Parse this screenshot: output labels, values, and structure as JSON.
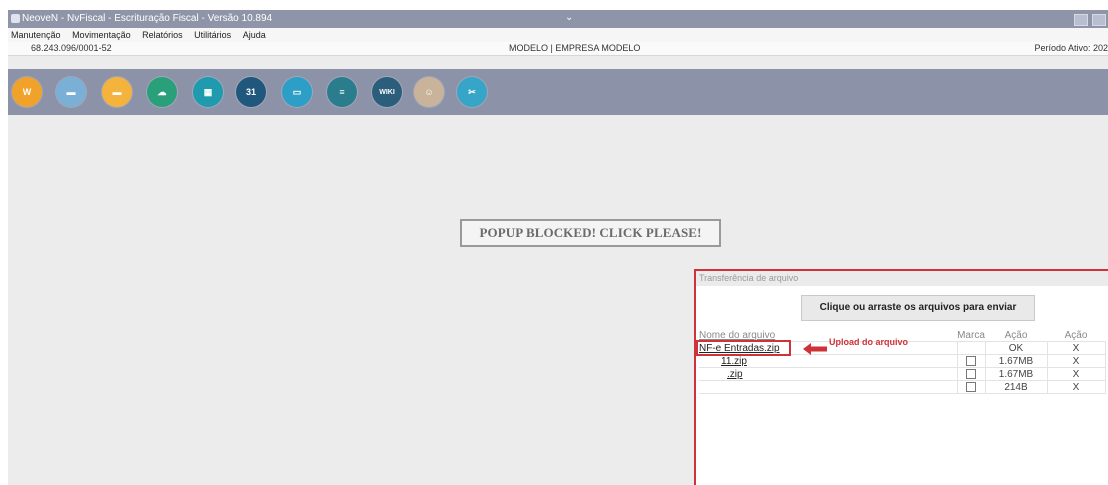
{
  "window": {
    "title": "NeoveN - NvFiscal - Escrituração Fiscal - Versão 10.894",
    "title_chevron": "⌄",
    "minimize": "",
    "maximize": ""
  },
  "menu": [
    "Manutenção",
    "Movimentação",
    "Relatórios",
    "Utilitários",
    "Ajuda"
  ],
  "info": {
    "cnpj": "68.243.096/0001-52",
    "company": "MODELO | EMPRESA MODELO",
    "period": "Período Ativo: 202"
  },
  "toolbar": {
    "buttons": [
      {
        "name": "word-icon",
        "glyph": "W",
        "color": "#f0a22a"
      },
      {
        "name": "badge-blue-icon",
        "glyph": "▬",
        "color": "#7ab0d6"
      },
      {
        "name": "badge-orange-icon",
        "glyph": "▬",
        "color": "#f3b33d"
      },
      {
        "name": "cloud-download-icon",
        "glyph": "☁",
        "color": "#2aa07a"
      },
      {
        "name": "spreadsheet-icon",
        "glyph": "▦",
        "color": "#1f9bb0"
      },
      {
        "name": "calendar-icon",
        "glyph": "31",
        "color": "#20577d"
      },
      {
        "name": "monitor-icon",
        "glyph": "▭",
        "color": "#2d9fc7"
      },
      {
        "name": "database-icon",
        "glyph": "≡",
        "color": "#2a7d8c"
      },
      {
        "name": "wiki-icon",
        "glyph": "WIKI",
        "color": "#2b5e7a"
      },
      {
        "name": "support-agent-icon",
        "glyph": "☺",
        "color": "#c9b39a"
      },
      {
        "name": "tools-icon",
        "glyph": "✂",
        "color": "#37a5c8"
      }
    ]
  },
  "popup": {
    "label": "POPUP BLOCKED! CLICK PLEASE!"
  },
  "transfer": {
    "title": "Transferência de arquivo",
    "upload_label": "Clique ou arraste os arquivos para enviar",
    "columns": [
      "Nome do arquivo",
      "Marca",
      "Ação",
      "Ação"
    ],
    "rows": [
      {
        "name": "NF-e Entradas.zip",
        "mark": false,
        "status": "OK",
        "action": "X"
      },
      {
        "name": "11.zip",
        "mark": true,
        "status": "1.67MB",
        "action": "X"
      },
      {
        "name": ".zip",
        "mark": true,
        "status": "1.67MB",
        "action": "X"
      },
      {
        "name": "",
        "mark": true,
        "status": "214B",
        "action": "X"
      }
    ],
    "annotation": "Upload do arquivo",
    "annotation_color": "#d0323a"
  }
}
